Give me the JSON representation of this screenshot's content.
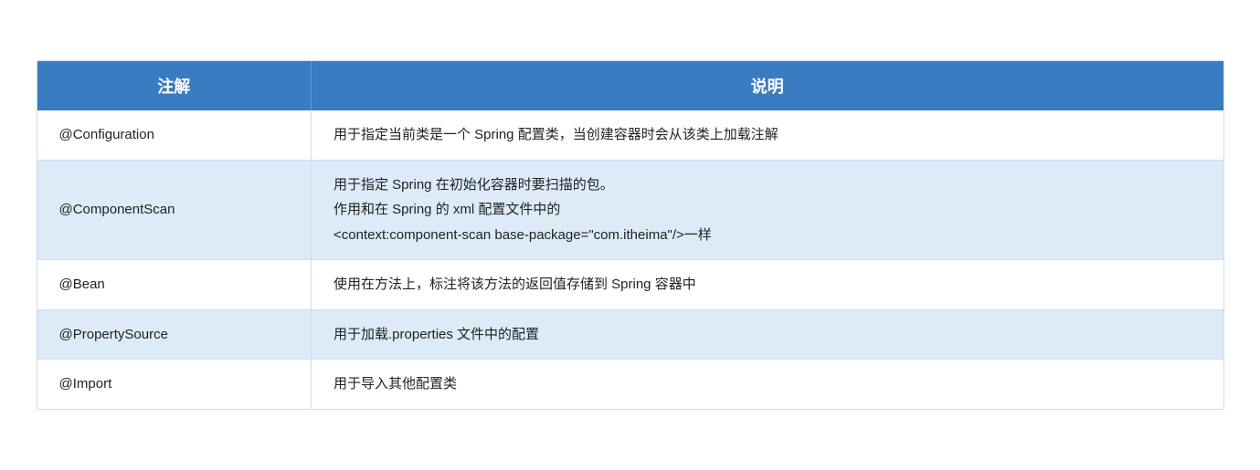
{
  "table": {
    "header": {
      "col1": "注解",
      "col2": "说明"
    },
    "rows": [
      {
        "annotation": "@Configuration",
        "description": "用于指定当前类是一个 Spring 配置类，当创建容器时会从该类上加载注解"
      },
      {
        "annotation": "@ComponentScan",
        "description_lines": [
          "用于指定 Spring 在初始化容器时要扫描的包。",
          "作用和在 Spring 的 xml 配置文件中的",
          "<context:component-scan  base-package=\"com.itheima\"/>一样"
        ]
      },
      {
        "annotation": "@Bean",
        "description": "使用在方法上，标注将该方法的返回值存储到 Spring 容器中"
      },
      {
        "annotation": "@PropertySource",
        "description": "用于加载.properties  文件中的配置"
      },
      {
        "annotation": "@Import",
        "description": "用于导入其他配置类"
      }
    ]
  }
}
